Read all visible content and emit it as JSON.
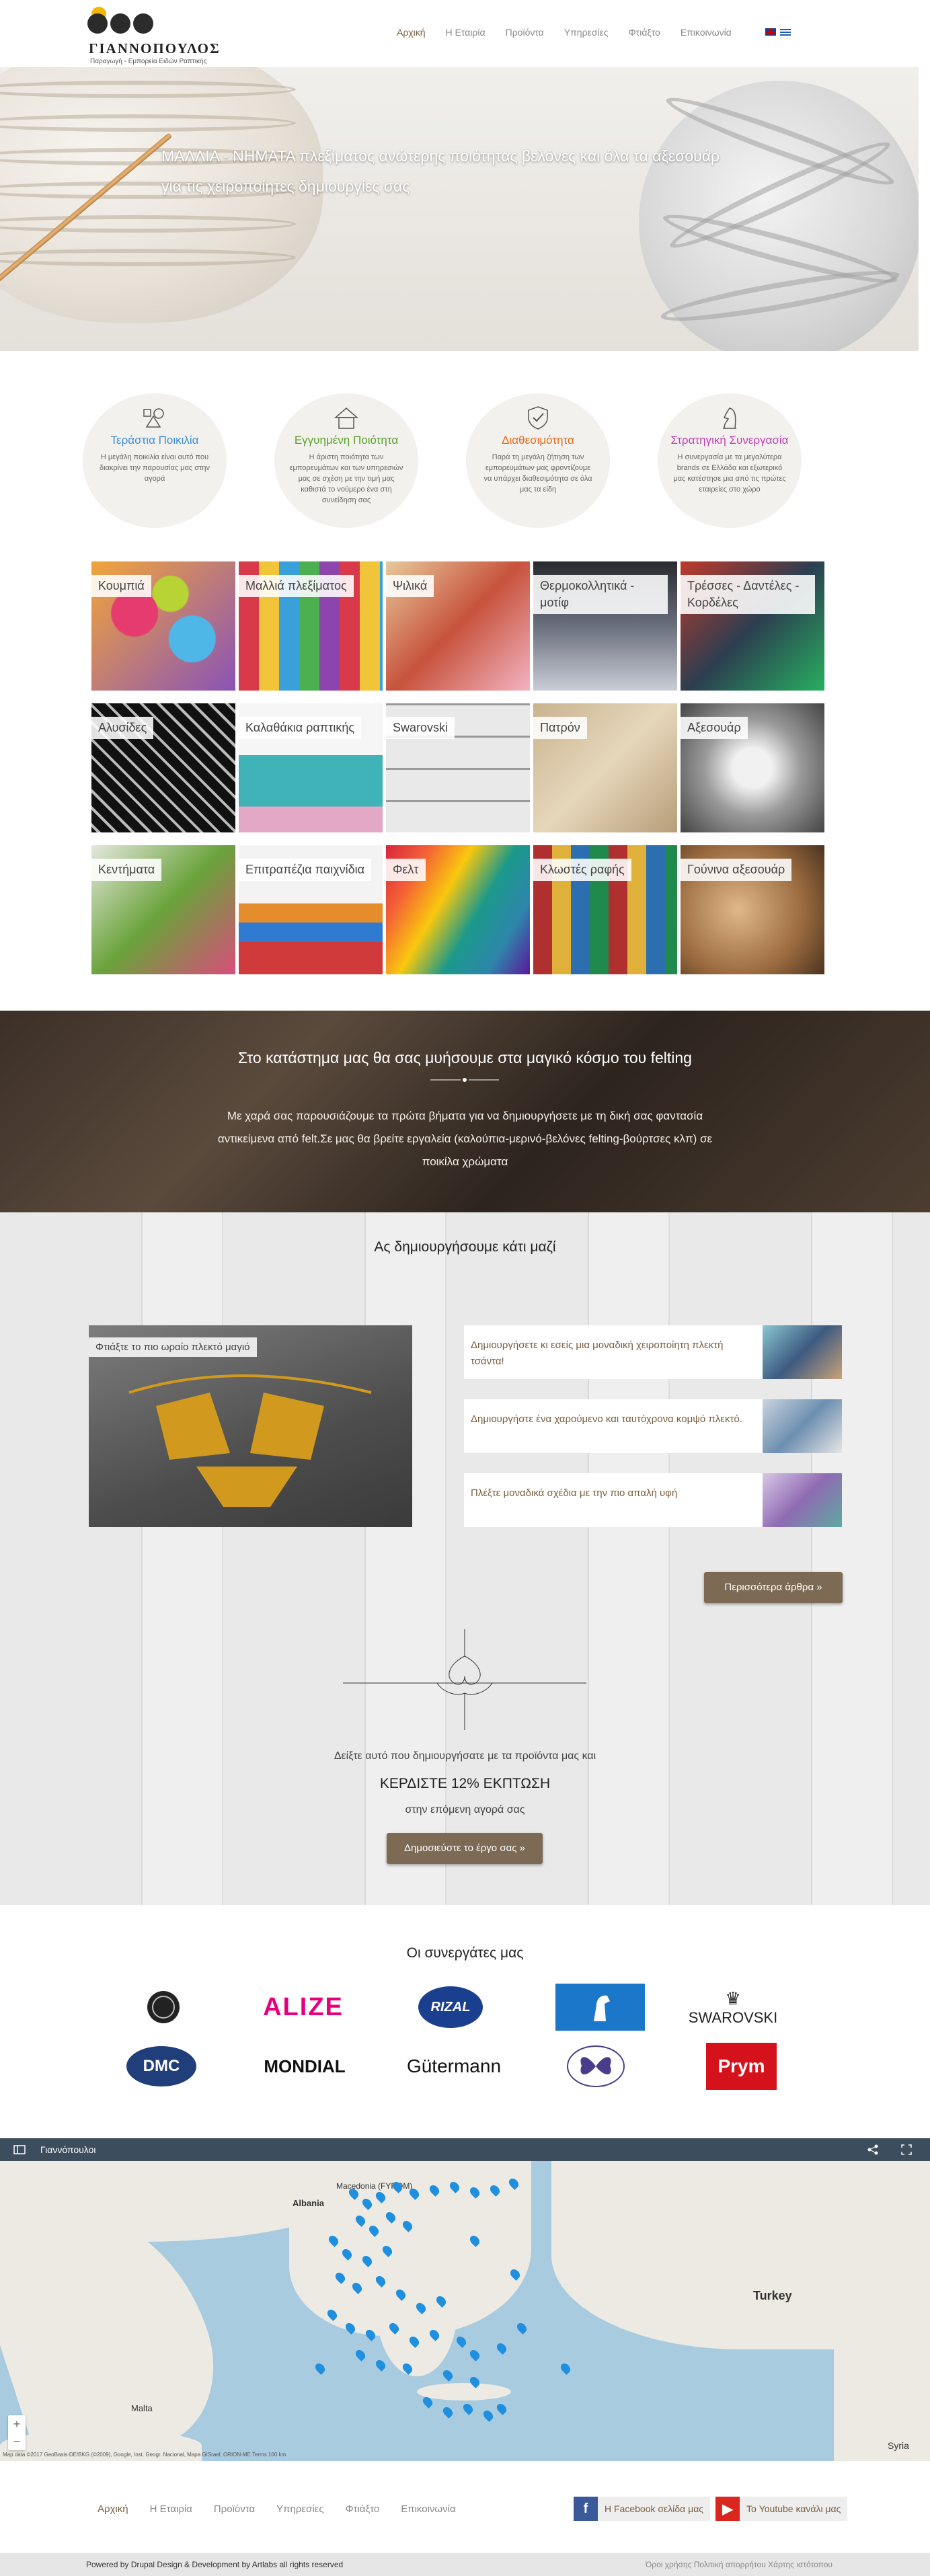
{
  "header": {
    "logo_name": "ΓΙΑΝΝΟΠΟΥΛΟΣ",
    "logo_tagline": "Παραγωγή - Εμπορεία Ειδών Ραπτικής",
    "nav": [
      "Αρχική",
      "Η Εταιρία",
      "Προϊόντα",
      "Υπηρεσίες",
      "Φτιάξτο",
      "Επικοινωνία"
    ],
    "active_nav": "Αρχική",
    "flags": [
      "en-flag-icon",
      "gr-flag-icon"
    ]
  },
  "hero": {
    "text": "ΜΑΛΛΙΑ - ΝΗΜΑΤΑ πλεξίματος ανώτερης ποιότητας βελόνες και όλα τα αξεσουάρ για τις χειροποίητες δημιουργίες σας"
  },
  "features": [
    {
      "title": "Τεράστια Ποικιλία",
      "text": "Η μεγάλη ποικιλία είναι αυτό που διακρίνει την παρουσίας μας στην αγορά",
      "color": "#3b8fd6",
      "icon": "shapes-icon"
    },
    {
      "title": "Εγγυημένη Ποιότητα",
      "text": "Η άριστη ποιότητα των εμπορευμάτων και των υπηρεσιών μας σε σχέση με την τιμή μας καθιστά το νούμερο ένα στη συνείδηση σας",
      "color": "#5aa02c",
      "icon": "house-icon"
    },
    {
      "title": "Διαθεσιμότητα",
      "text": "Παρά τη μεγάλη ζήτηση των εμπορευμάτων μας φροντίζουμε να υπάρχει διαθεσιμότητα σε όλα μας τα είδη",
      "color": "#e8691f",
      "icon": "shield-check-icon"
    },
    {
      "title": "Στρατηγική Συνεργασία",
      "text": "Η συνεργασία με τα μεγαλύτερα brands σε Ελλάδα και εξωτερικό μας κατέστησε μια από τις πρώτες εταιρείες στο χώρο",
      "color": "#c13fb3",
      "icon": "chess-knight-icon"
    }
  ],
  "categories": [
    {
      "label": "Κουμπιά"
    },
    {
      "label": "Μαλλιά πλεξίματος"
    },
    {
      "label": "Ψιλικά"
    },
    {
      "label": "Θερμοκολλητικά - μοτίφ"
    },
    {
      "label": "Τρέσσες - Δαντέλες - Κορδέλες"
    },
    {
      "label": "Αλυσίδες"
    },
    {
      "label": "Καλαθάκια ραπτικής"
    },
    {
      "label": "Swarovski"
    },
    {
      "label": "Πατρόν"
    },
    {
      "label": "Αξεσουάρ"
    },
    {
      "label": "Κεντήματα"
    },
    {
      "label": "Επιτραπέζια παιχνίδια"
    },
    {
      "label": "Φελτ"
    },
    {
      "label": "Κλωστές ραφής"
    },
    {
      "label": "Γούνινα αξεσουάρ"
    }
  ],
  "felting": {
    "title": "Στο κατάστημα μας θα σας μυήσουμε στα μαγικό κόσμο του felting",
    "text": "Με χαρά σας παρουσιάζουμε τα πρώτα βήματα για να δημιουργήσετε με τη δική σας φαντασία αντικείμενα από felt.Σε μας θα βρείτε εργαλεία (καλούπια-μερινό-βελόνες felting-βούρτσες κλπ) σε ποικίλα χρώματα"
  },
  "create": {
    "title": "Ας δημιουργήσουμε κάτι μαζί",
    "featured_label": "Φτιάξτε το πιο ωραίο πλεκτό μαγιό",
    "articles": [
      "Δημιουργήσετε κι εσείς μια μοναδική χειροποίητη πλεκτή τσάντα!",
      "Δημιουργήστε ένα χαρούμενο και ταυτόχρονα κομψό πλεκτό.",
      "Πλέξτε μοναδικά σχέδια με την πιο απαλή υφή"
    ],
    "more_button": "Περισσότερα άρθρα »",
    "promo_line1": "Δείξτε αυτό που δημιουργήσατε με τα προϊόντα μας και",
    "promo_line2": "ΚΕΡΔΙΣΤΕ 12% ΕΚΠΤΩΣΗ",
    "promo_line3": "στην επόμενη αγορά σας",
    "publish_button": "Δημοσιεύστε το έργο σας »"
  },
  "partners": {
    "title": "Οι συνεργάτες μας",
    "logos": [
      "ALIZE",
      "RIZAL",
      "SWAROVSKI",
      "DMC",
      "MONDIAL",
      "Gütermann",
      "Prym"
    ]
  },
  "map": {
    "title": "Γιαννόπουλοι",
    "labels": [
      "Macedonia (FYROM)",
      "Albania",
      "Turkey",
      "Malta",
      "Syria"
    ],
    "credit": "Map data ©2017 GeoBasis-DE/BKG (©2009), Google, Inst. Geogr. Nacional, Mapa GISrael, ORION-ME   Terms   100 km"
  },
  "footer": {
    "nav": [
      "Αρχική",
      "Η Εταιρία",
      "Προϊόντα",
      "Υπηρεσίες",
      "Φτιάξτο",
      "Επικοινωνία"
    ],
    "facebook": "Η Facebook σελίδα μας",
    "youtube": "Το Youtube κανάλι μας",
    "powered": "Powered by Drupal Design & Development by Artlabs all rights reserved",
    "links": "Όροι χρήσης   Πολιτική απορρήτου   Χάρτης ιστότοπου"
  },
  "colors": {
    "accent": "#7a5c3a",
    "button": "#7d6a55",
    "mapbar": "#3c4d5d",
    "pin": "#1f8fe0"
  }
}
